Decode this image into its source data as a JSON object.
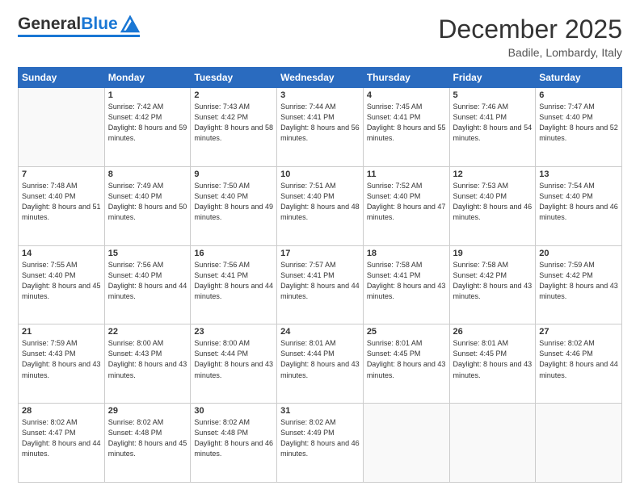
{
  "logo": {
    "general": "General",
    "blue": "Blue"
  },
  "title": "December 2025",
  "location": "Badile, Lombardy, Italy",
  "days_header": [
    "Sunday",
    "Monday",
    "Tuesday",
    "Wednesday",
    "Thursday",
    "Friday",
    "Saturday"
  ],
  "weeks": [
    [
      {
        "num": "",
        "empty": true
      },
      {
        "num": "1",
        "sunrise": "Sunrise: 7:42 AM",
        "sunset": "Sunset: 4:42 PM",
        "daylight": "Daylight: 8 hours and 59 minutes."
      },
      {
        "num": "2",
        "sunrise": "Sunrise: 7:43 AM",
        "sunset": "Sunset: 4:42 PM",
        "daylight": "Daylight: 8 hours and 58 minutes."
      },
      {
        "num": "3",
        "sunrise": "Sunrise: 7:44 AM",
        "sunset": "Sunset: 4:41 PM",
        "daylight": "Daylight: 8 hours and 56 minutes."
      },
      {
        "num": "4",
        "sunrise": "Sunrise: 7:45 AM",
        "sunset": "Sunset: 4:41 PM",
        "daylight": "Daylight: 8 hours and 55 minutes."
      },
      {
        "num": "5",
        "sunrise": "Sunrise: 7:46 AM",
        "sunset": "Sunset: 4:41 PM",
        "daylight": "Daylight: 8 hours and 54 minutes."
      },
      {
        "num": "6",
        "sunrise": "Sunrise: 7:47 AM",
        "sunset": "Sunset: 4:40 PM",
        "daylight": "Daylight: 8 hours and 52 minutes."
      }
    ],
    [
      {
        "num": "7",
        "sunrise": "Sunrise: 7:48 AM",
        "sunset": "Sunset: 4:40 PM",
        "daylight": "Daylight: 8 hours and 51 minutes."
      },
      {
        "num": "8",
        "sunrise": "Sunrise: 7:49 AM",
        "sunset": "Sunset: 4:40 PM",
        "daylight": "Daylight: 8 hours and 50 minutes."
      },
      {
        "num": "9",
        "sunrise": "Sunrise: 7:50 AM",
        "sunset": "Sunset: 4:40 PM",
        "daylight": "Daylight: 8 hours and 49 minutes."
      },
      {
        "num": "10",
        "sunrise": "Sunrise: 7:51 AM",
        "sunset": "Sunset: 4:40 PM",
        "daylight": "Daylight: 8 hours and 48 minutes."
      },
      {
        "num": "11",
        "sunrise": "Sunrise: 7:52 AM",
        "sunset": "Sunset: 4:40 PM",
        "daylight": "Daylight: 8 hours and 47 minutes."
      },
      {
        "num": "12",
        "sunrise": "Sunrise: 7:53 AM",
        "sunset": "Sunset: 4:40 PM",
        "daylight": "Daylight: 8 hours and 46 minutes."
      },
      {
        "num": "13",
        "sunrise": "Sunrise: 7:54 AM",
        "sunset": "Sunset: 4:40 PM",
        "daylight": "Daylight: 8 hours and 46 minutes."
      }
    ],
    [
      {
        "num": "14",
        "sunrise": "Sunrise: 7:55 AM",
        "sunset": "Sunset: 4:40 PM",
        "daylight": "Daylight: 8 hours and 45 minutes."
      },
      {
        "num": "15",
        "sunrise": "Sunrise: 7:56 AM",
        "sunset": "Sunset: 4:40 PM",
        "daylight": "Daylight: 8 hours and 44 minutes."
      },
      {
        "num": "16",
        "sunrise": "Sunrise: 7:56 AM",
        "sunset": "Sunset: 4:41 PM",
        "daylight": "Daylight: 8 hours and 44 minutes."
      },
      {
        "num": "17",
        "sunrise": "Sunrise: 7:57 AM",
        "sunset": "Sunset: 4:41 PM",
        "daylight": "Daylight: 8 hours and 44 minutes."
      },
      {
        "num": "18",
        "sunrise": "Sunrise: 7:58 AM",
        "sunset": "Sunset: 4:41 PM",
        "daylight": "Daylight: 8 hours and 43 minutes."
      },
      {
        "num": "19",
        "sunrise": "Sunrise: 7:58 AM",
        "sunset": "Sunset: 4:42 PM",
        "daylight": "Daylight: 8 hours and 43 minutes."
      },
      {
        "num": "20",
        "sunrise": "Sunrise: 7:59 AM",
        "sunset": "Sunset: 4:42 PM",
        "daylight": "Daylight: 8 hours and 43 minutes."
      }
    ],
    [
      {
        "num": "21",
        "sunrise": "Sunrise: 7:59 AM",
        "sunset": "Sunset: 4:43 PM",
        "daylight": "Daylight: 8 hours and 43 minutes."
      },
      {
        "num": "22",
        "sunrise": "Sunrise: 8:00 AM",
        "sunset": "Sunset: 4:43 PM",
        "daylight": "Daylight: 8 hours and 43 minutes."
      },
      {
        "num": "23",
        "sunrise": "Sunrise: 8:00 AM",
        "sunset": "Sunset: 4:44 PM",
        "daylight": "Daylight: 8 hours and 43 minutes."
      },
      {
        "num": "24",
        "sunrise": "Sunrise: 8:01 AM",
        "sunset": "Sunset: 4:44 PM",
        "daylight": "Daylight: 8 hours and 43 minutes."
      },
      {
        "num": "25",
        "sunrise": "Sunrise: 8:01 AM",
        "sunset": "Sunset: 4:45 PM",
        "daylight": "Daylight: 8 hours and 43 minutes."
      },
      {
        "num": "26",
        "sunrise": "Sunrise: 8:01 AM",
        "sunset": "Sunset: 4:45 PM",
        "daylight": "Daylight: 8 hours and 43 minutes."
      },
      {
        "num": "27",
        "sunrise": "Sunrise: 8:02 AM",
        "sunset": "Sunset: 4:46 PM",
        "daylight": "Daylight: 8 hours and 44 minutes."
      }
    ],
    [
      {
        "num": "28",
        "sunrise": "Sunrise: 8:02 AM",
        "sunset": "Sunset: 4:47 PM",
        "daylight": "Daylight: 8 hours and 44 minutes."
      },
      {
        "num": "29",
        "sunrise": "Sunrise: 8:02 AM",
        "sunset": "Sunset: 4:48 PM",
        "daylight": "Daylight: 8 hours and 45 minutes."
      },
      {
        "num": "30",
        "sunrise": "Sunrise: 8:02 AM",
        "sunset": "Sunset: 4:48 PM",
        "daylight": "Daylight: 8 hours and 46 minutes."
      },
      {
        "num": "31",
        "sunrise": "Sunrise: 8:02 AM",
        "sunset": "Sunset: 4:49 PM",
        "daylight": "Daylight: 8 hours and 46 minutes."
      },
      {
        "num": "",
        "empty": true
      },
      {
        "num": "",
        "empty": true
      },
      {
        "num": "",
        "empty": true
      }
    ]
  ]
}
